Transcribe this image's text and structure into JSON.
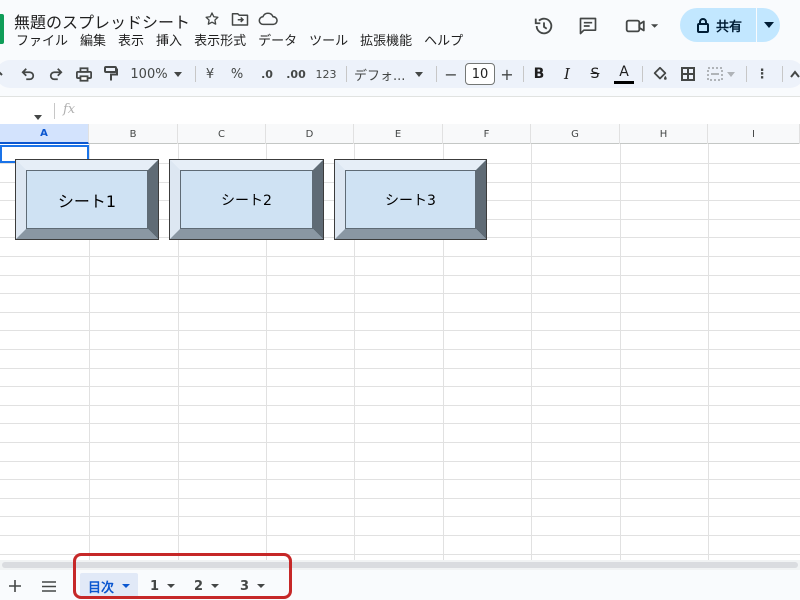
{
  "doc": {
    "title": "無題のスプレッドシート"
  },
  "menu": [
    "ファイル",
    "編集",
    "表示",
    "挿入",
    "表示形式",
    "データ",
    "ツール",
    "拡張機能",
    "ヘルプ"
  ],
  "share": {
    "label": "共有"
  },
  "toolbar": {
    "zoom": "100%",
    "currency": "¥",
    "percent": "%",
    "dec_decrease": ".0",
    "dec_increase": ".00",
    "number_format": "123",
    "font": "デフォ...",
    "font_size": "10",
    "font_minus": "−",
    "font_plus": "+",
    "bold": "B",
    "italic": "I",
    "strike": "S",
    "text_color": "A",
    "more": "⋮"
  },
  "formula_bar": {
    "fx": "fx"
  },
  "columns": [
    "A",
    "B",
    "C",
    "D",
    "E",
    "F",
    "G",
    "H",
    "I"
  ],
  "buttons": [
    {
      "label": "シート1"
    },
    {
      "label": "シート2"
    },
    {
      "label": "シート3"
    }
  ],
  "sheet_tabs": [
    {
      "label": "目次",
      "active": true
    },
    {
      "label": "1",
      "active": false
    },
    {
      "label": "2",
      "active": false
    },
    {
      "label": "3",
      "active": false
    }
  ],
  "colors": {
    "accent": "#0b57d0",
    "share_bg": "#c2e7ff",
    "button_face": "#cfe2f3",
    "highlight": "#c62828"
  }
}
